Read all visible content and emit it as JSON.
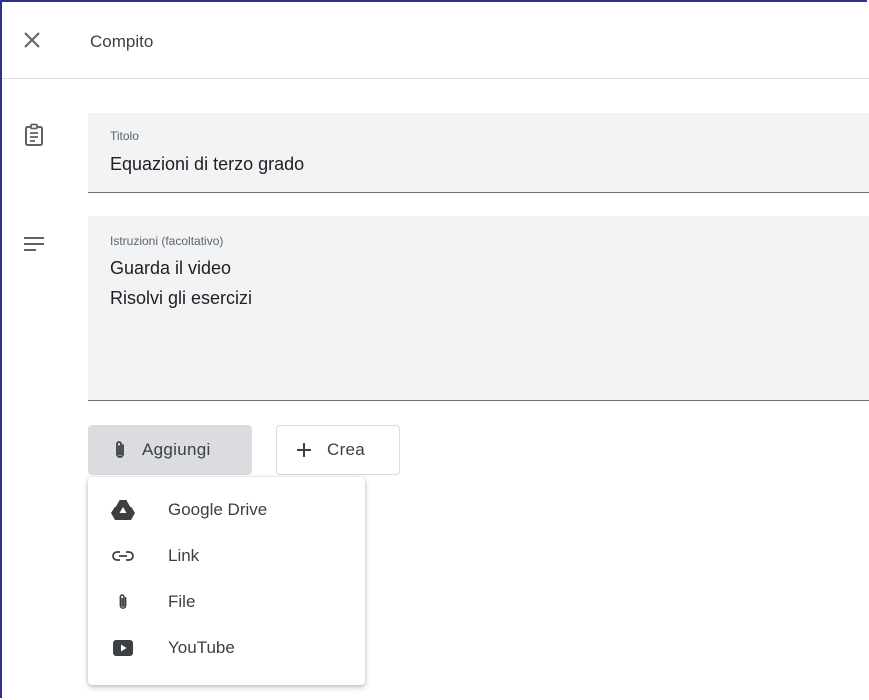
{
  "header": {
    "title": "Compito"
  },
  "form": {
    "title_field": {
      "label": "Titolo",
      "value": "Equazioni di terzo grado"
    },
    "instructions_field": {
      "label": "Istruzioni (facoltativo)",
      "value": "Guarda il video\nRisolvi gli esercizi"
    }
  },
  "actions": {
    "add_label": "Aggiungi",
    "create_label": "Crea"
  },
  "add_menu": {
    "items": [
      {
        "label": "Google Drive",
        "icon": "google-drive-icon"
      },
      {
        "label": "Link",
        "icon": "link-icon"
      },
      {
        "label": "File",
        "icon": "paperclip-icon"
      },
      {
        "label": "YouTube",
        "icon": "youtube-icon"
      }
    ]
  }
}
